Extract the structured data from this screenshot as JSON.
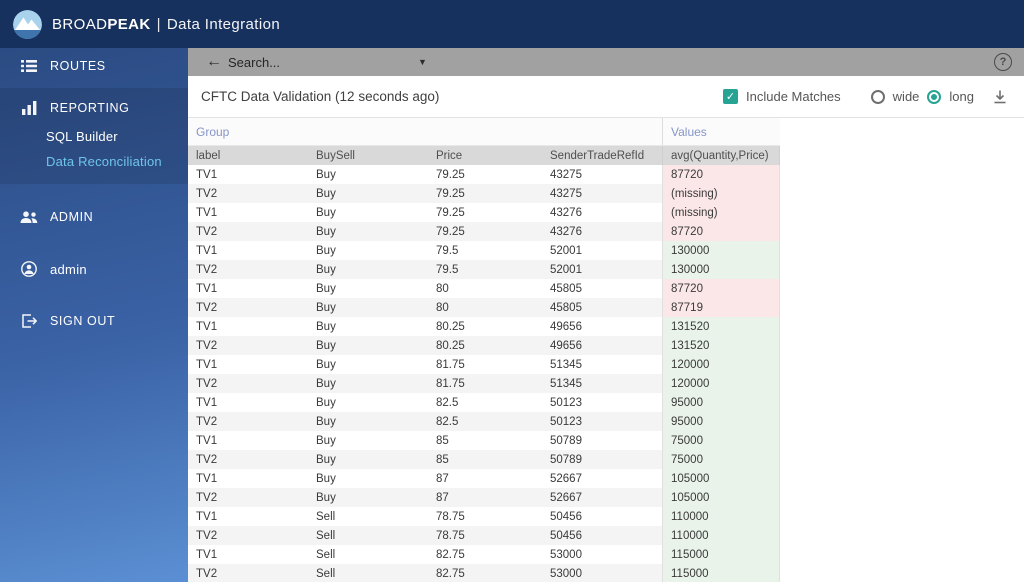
{
  "brand": {
    "broad": "BROAD",
    "peak": "PEAK",
    "separator": "|",
    "app": "Data Integration"
  },
  "sidebar": {
    "routes": "ROUTES",
    "reporting": "REPORTING",
    "sql_builder": "SQL Builder",
    "data_reconciliation": "Data Reconciliation",
    "admin": "ADMIN",
    "user": "admin",
    "sign_out": "SIGN OUT"
  },
  "search": {
    "placeholder": "Search...",
    "help_glyph": "?"
  },
  "report": {
    "title": "CFTC Data Validation (12 seconds ago)",
    "include_matches_label": "Include Matches",
    "include_matches_checked": true,
    "wide_label": "wide",
    "wide_selected": false,
    "long_label": "long",
    "long_selected": true
  },
  "table": {
    "group_header": "Group",
    "values_header": "Values",
    "columns": [
      "label",
      "BuySell",
      "Price",
      "SenderTradeRefId",
      "avg(Quantity,Price)"
    ],
    "column_keys": [
      "label",
      "buysell",
      "price",
      "sendertraderefid",
      "value"
    ],
    "rows": [
      [
        "TV1",
        "Buy",
        "79.25",
        "43275",
        "87720",
        "mismatch"
      ],
      [
        "TV2",
        "Buy",
        "79.25",
        "43275",
        "(missing)",
        "mismatch"
      ],
      [
        "TV1",
        "Buy",
        "79.25",
        "43276",
        "(missing)",
        "mismatch"
      ],
      [
        "TV2",
        "Buy",
        "79.25",
        "43276",
        "87720",
        "mismatch"
      ],
      [
        "TV1",
        "Buy",
        "79.5",
        "52001",
        "130000",
        "match"
      ],
      [
        "TV2",
        "Buy",
        "79.5",
        "52001",
        "130000",
        "match"
      ],
      [
        "TV1",
        "Buy",
        "80",
        "45805",
        "87720",
        "mismatch"
      ],
      [
        "TV2",
        "Buy",
        "80",
        "45805",
        "87719",
        "mismatch"
      ],
      [
        "TV1",
        "Buy",
        "80.25",
        "49656",
        "131520",
        "match"
      ],
      [
        "TV2",
        "Buy",
        "80.25",
        "49656",
        "131520",
        "match"
      ],
      [
        "TV1",
        "Buy",
        "81.75",
        "51345",
        "120000",
        "match"
      ],
      [
        "TV2",
        "Buy",
        "81.75",
        "51345",
        "120000",
        "match"
      ],
      [
        "TV1",
        "Buy",
        "82.5",
        "50123",
        "95000",
        "match"
      ],
      [
        "TV2",
        "Buy",
        "82.5",
        "50123",
        "95000",
        "match"
      ],
      [
        "TV1",
        "Buy",
        "85",
        "50789",
        "75000",
        "match"
      ],
      [
        "TV2",
        "Buy",
        "85",
        "50789",
        "75000",
        "match"
      ],
      [
        "TV1",
        "Buy",
        "87",
        "52667",
        "105000",
        "match"
      ],
      [
        "TV2",
        "Buy",
        "87",
        "52667",
        "105000",
        "match"
      ],
      [
        "TV1",
        "Sell",
        "78.75",
        "50456",
        "110000",
        "match"
      ],
      [
        "TV2",
        "Sell",
        "78.75",
        "50456",
        "110000",
        "match"
      ],
      [
        "TV1",
        "Sell",
        "82.75",
        "53000",
        "115000",
        "match"
      ],
      [
        "TV2",
        "Sell",
        "82.75",
        "53000",
        "115000",
        "match"
      ]
    ]
  },
  "colors": {
    "topbar_navy": "#17315e",
    "sidebar_top": "#2b4b83",
    "sidebar_bottom": "#5b8fd3",
    "active_link_cyan": "#6fc5ea",
    "accent_teal": "#27a394",
    "match_green_bg": "#e9f3ea",
    "mismatch_pink_bg": "#fbe7e7",
    "searchbar_gray": "#a1a1a1",
    "group_header_blue": "#8695c7"
  }
}
